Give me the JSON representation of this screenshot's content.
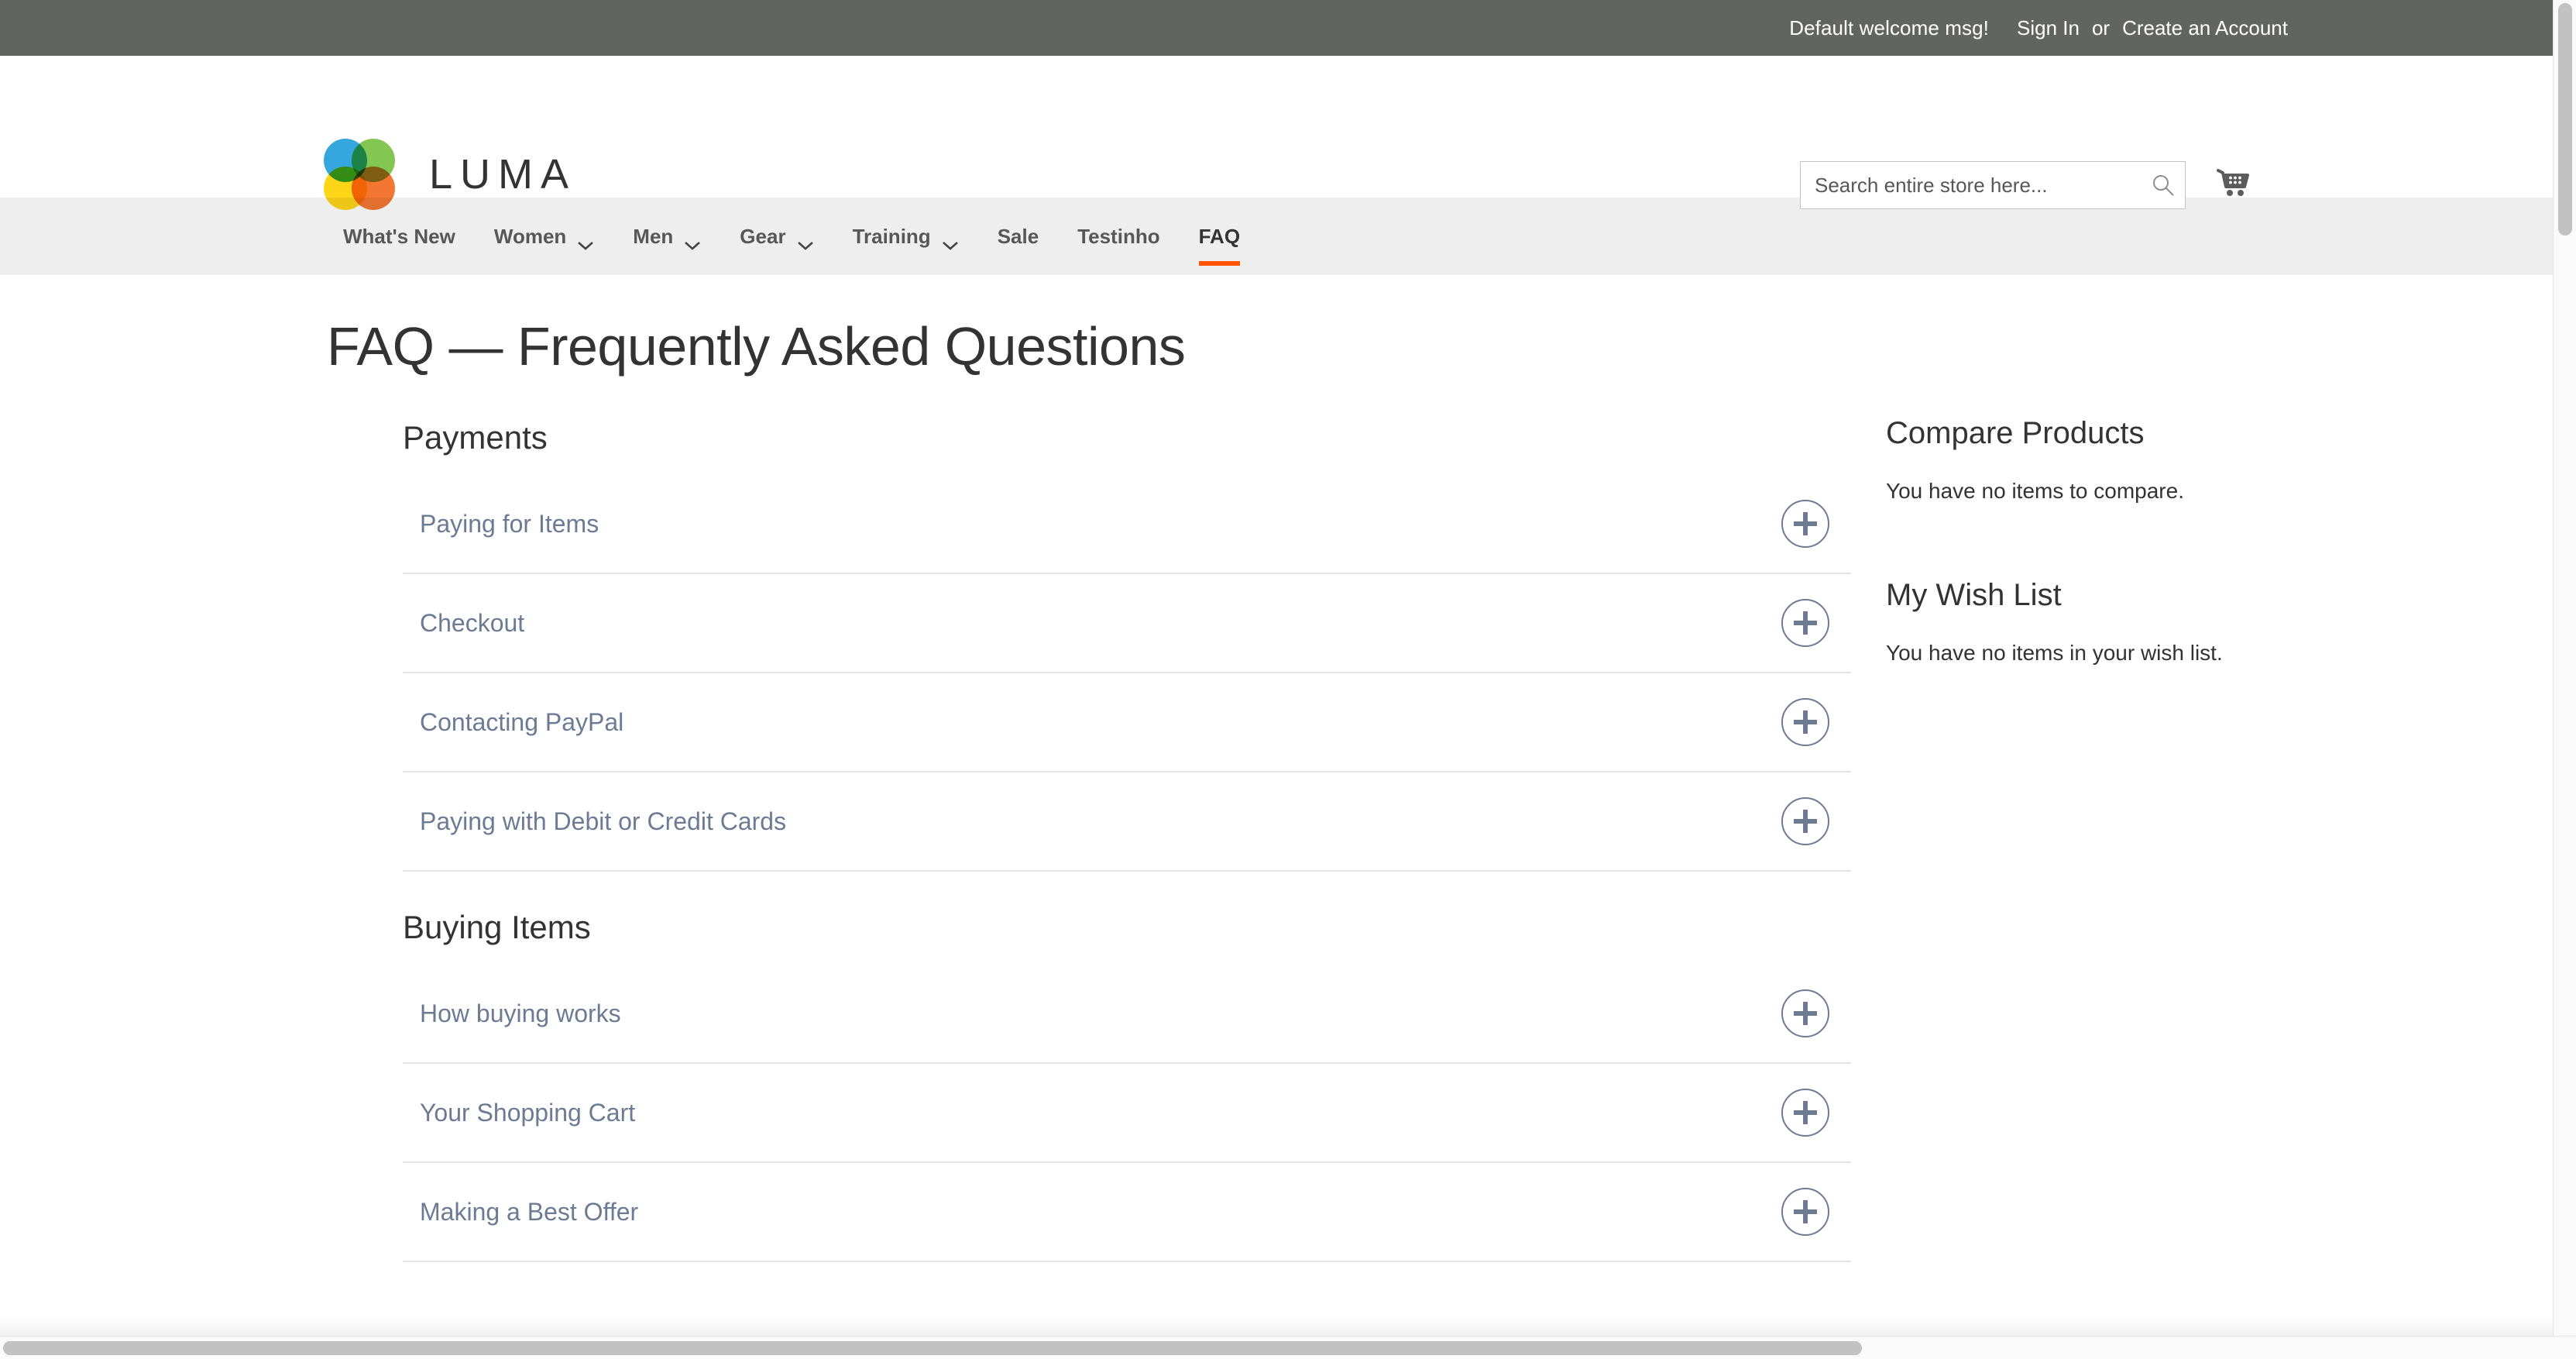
{
  "topbar": {
    "welcome": "Default welcome msg!",
    "sign_in": "Sign In",
    "separator": "or",
    "create_account": "Create an Account"
  },
  "header": {
    "logo_text": "LUMA",
    "search_placeholder": "Search entire store here...",
    "search_value": "",
    "search_icon": "search-icon",
    "cart_icon": "shopping-cart-icon"
  },
  "nav": {
    "items": [
      {
        "label": "What's New",
        "has_dropdown": false,
        "active": false
      },
      {
        "label": "Women",
        "has_dropdown": true,
        "active": false
      },
      {
        "label": "Men",
        "has_dropdown": true,
        "active": false
      },
      {
        "label": "Gear",
        "has_dropdown": true,
        "active": false
      },
      {
        "label": "Training",
        "has_dropdown": true,
        "active": false
      },
      {
        "label": "Sale",
        "has_dropdown": false,
        "active": false
      },
      {
        "label": "Testinho",
        "has_dropdown": false,
        "active": false
      },
      {
        "label": "FAQ",
        "has_dropdown": false,
        "active": true
      }
    ]
  },
  "page": {
    "title": "FAQ — Frequently Asked Questions"
  },
  "faq": {
    "groups": [
      {
        "title": "Payments",
        "items": [
          {
            "label": "Paying for Items",
            "expanded": false,
            "toggle_icon": "plus-icon"
          },
          {
            "label": "Checkout",
            "expanded": false,
            "toggle_icon": "plus-icon"
          },
          {
            "label": "Contacting PayPal",
            "expanded": false,
            "toggle_icon": "plus-icon"
          },
          {
            "label": "Paying with Debit or Credit Cards",
            "expanded": false,
            "toggle_icon": "plus-icon"
          }
        ]
      },
      {
        "title": "Buying Items",
        "items": [
          {
            "label": "How buying works",
            "expanded": false,
            "toggle_icon": "plus-icon"
          },
          {
            "label": "Your Shopping Cart",
            "expanded": false,
            "toggle_icon": "plus-icon"
          },
          {
            "label": "Making a Best Offer",
            "expanded": false,
            "toggle_icon": "plus-icon"
          }
        ]
      }
    ]
  },
  "sidebar": {
    "blocks": [
      {
        "title": "Compare Products",
        "text": "You have no items to compare."
      },
      {
        "title": "My Wish List",
        "text": "You have no items in your wish list."
      }
    ]
  },
  "colors": {
    "topbar_bg": "#62645f",
    "nav_bg": "#eeeeee",
    "accent": "#ff5501",
    "link": "#6c7b93",
    "text": "#333333"
  }
}
